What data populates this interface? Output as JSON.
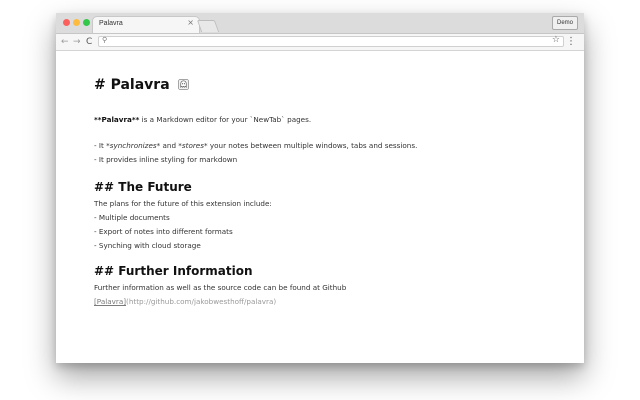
{
  "browser": {
    "tab_title": "Palavra",
    "tab_close": "×",
    "profile_label": "Demo",
    "icons": {
      "back": "back-arrow-icon",
      "forward": "forward-arrow-icon",
      "reload": "reload-icon",
      "search": "search-icon",
      "star": "star-icon",
      "menu": "menu-dots-icon"
    },
    "glyphs": {
      "back": "←",
      "forward": "→",
      "reload": "C",
      "search": "⚲",
      "star": "☆",
      "menu": "⋮"
    },
    "colors": {
      "close": "#fc605c",
      "minimize": "#fdbc40",
      "maximize": "#34c84a"
    }
  },
  "doc": {
    "h1": "# Palavra",
    "intro_bold": "**Palavra**",
    "intro_rest": " is a Markdown editor for your `NewTab` pages.",
    "b1_pre": "- It ",
    "b1_em1": "*synchronizes*",
    "b1_mid": " and ",
    "b1_em2": "*stores*",
    "b1_post": " your notes between multiple windows, tabs and sessions.",
    "b2": "- It provides inline styling for markdown",
    "h2_future": "## The Future",
    "future_intro": "The plans for the future of this extension include:",
    "future_items": [
      "- Multiple documents",
      "- Export of notes into different formats",
      "- Synching with cloud storage"
    ],
    "h2_further": "## Further Information",
    "further_text": "Further information as well as the source code can be found at Github",
    "link_text": "[Palavra]",
    "link_url": "(http://github.com/jakobwesthoff/palavra)"
  }
}
